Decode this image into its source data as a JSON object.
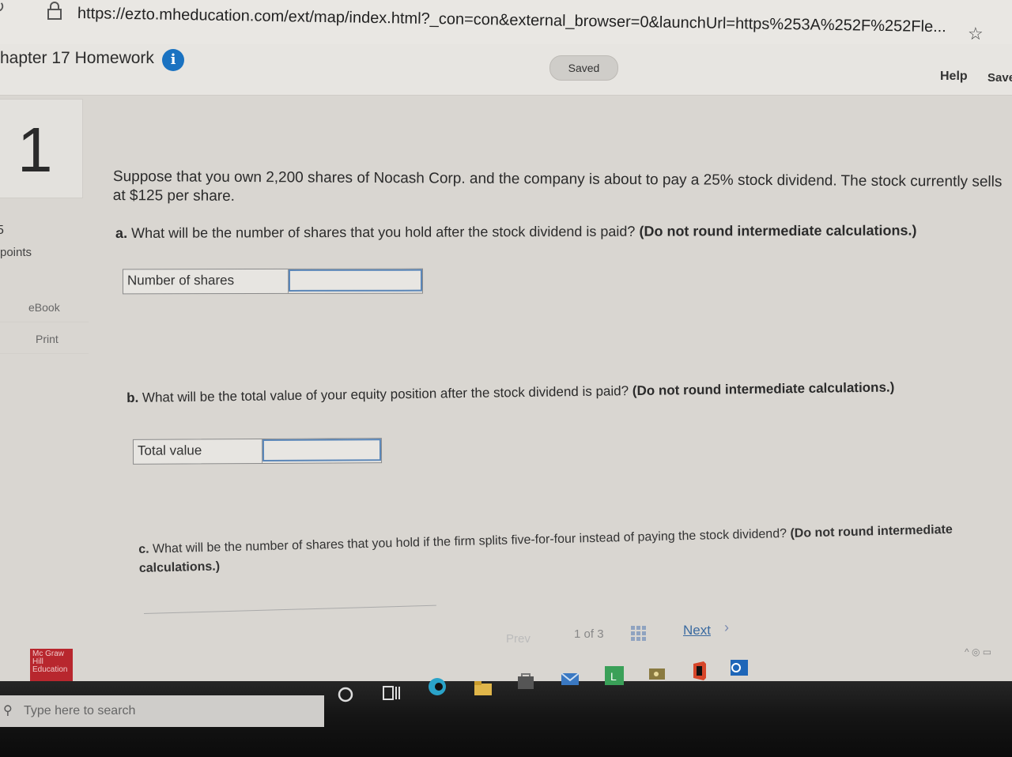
{
  "browser": {
    "url": "https://ezto.mheducation.com/ext/map/index.html?_con=con&external_browser=0&launchUrl=https%253A%252F%252Fle...",
    "bookmark_icon": "star-icon",
    "secure_icon": "lock-icon"
  },
  "header": {
    "title": "hapter 17 Homework",
    "info_icon": "info-icon",
    "status": "Saved",
    "help": "Help",
    "save": "Save"
  },
  "rail": {
    "question_number": "1",
    "points_value": "5",
    "points_label": "points",
    "ebook": "eBook",
    "print": "Print",
    "logo_text": "Mc Graw Hill Education"
  },
  "question": {
    "stem": "Suppose that you own 2,200 shares of Nocash Corp. and the company is about to pay a 25% stock dividend. The stock currently sells at $125 per share.",
    "part_a": {
      "letter": "a.",
      "text": "What will be the number of shares that you hold after the stock dividend is paid?",
      "note": "(Do not round intermediate calculations.)",
      "field_label": "Number of shares",
      "field_value": ""
    },
    "part_b": {
      "letter": "b.",
      "text": "What will be the total value of your equity position after the stock dividend is paid?",
      "note": "(Do not round intermediate calculations.)",
      "field_label": "Total value",
      "field_value": ""
    },
    "part_c": {
      "letter": "c.",
      "text": "What will be the number of shares that you hold if the firm splits five-for-four instead of paying the stock dividend?",
      "note": "(Do not round intermediate calculations.)"
    }
  },
  "pager": {
    "prev": "Prev",
    "current": "1",
    "of": "of",
    "total": "3",
    "next": "Next"
  },
  "taskbar": {
    "search_placeholder": "Type here to search"
  }
}
